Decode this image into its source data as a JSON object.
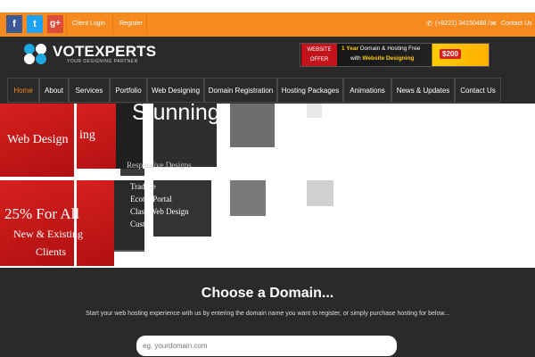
{
  "topbar": {
    "social": {
      "facebook": "f",
      "twitter": "t",
      "google_plus": "g+"
    },
    "client_login": "Client Login",
    "register": "Register",
    "phone": "(+8221) 34150488 /",
    "contact": "Contact Us",
    "icons": {
      "phone": "phone-icon",
      "mail": "envelope-icon"
    }
  },
  "header": {
    "logo_text": "VOTEXPERTS",
    "logo_tagline": "YOUR DESIGNING PARTNER",
    "banner": {
      "badge_line1": "WEBSITE",
      "badge_line2": "OFFER",
      "line1_prefix": "1 Year",
      "line1_rest": " Domain & Hosting Free",
      "line2_prefix": "with ",
      "line2_bold": "Website Designing",
      "price": "$200"
    }
  },
  "nav": {
    "items": [
      {
        "label": "Home",
        "active": true
      },
      {
        "label": "About"
      },
      {
        "label": "Services"
      },
      {
        "label": "Portfolio"
      },
      {
        "label": "Web Designing"
      },
      {
        "label": "Domain Registration"
      },
      {
        "label": "Hosting Packages"
      },
      {
        "label": "Animations"
      },
      {
        "label": "News & Updates"
      },
      {
        "label": "Contact Us"
      }
    ]
  },
  "hero": {
    "stunning": "Stunning",
    "web_design_left": "Web Design",
    "web_design_right": "ing",
    "responsive": "Responsive Designs",
    "offer_big": "25% For All",
    "offer_mid": "New & Existing",
    "offer_low": "Clients",
    "list": [
      "Tradece",
      "Ecotel Portal",
      "Class Web Design",
      "Cust"
    ]
  },
  "domain": {
    "title": "Choose a Domain...",
    "subtitle": "Start your web hosting experience with us by entering the domain name you want to register, or simply purchase hosting for below...",
    "placeholder": "eg. yourdomain.com"
  },
  "colors": {
    "accent_orange": "#f58a1f",
    "dark_bg": "#2b2929",
    "red": "#d62020"
  }
}
